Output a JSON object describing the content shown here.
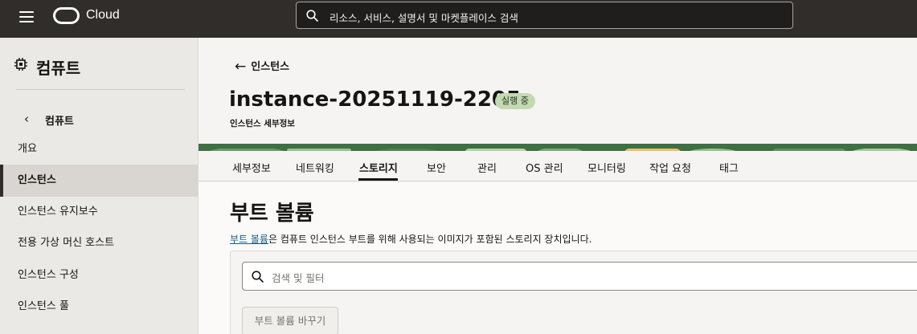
{
  "header": {
    "brand": "Cloud",
    "search_placeholder": "리소스, 서비스, 설명서 및 마켓플레이스 검색"
  },
  "sidebar": {
    "title": "컴퓨트",
    "back_label": "컴퓨트",
    "items": [
      {
        "label": "개요",
        "active": false
      },
      {
        "label": "인스턴스",
        "active": true
      },
      {
        "label": "인스턴스 유지보수",
        "active": false
      },
      {
        "label": "전용 가상 머신 호스트",
        "active": false
      },
      {
        "label": "인스턴스 구성",
        "active": false
      },
      {
        "label": "인스턴스 풀",
        "active": false
      }
    ]
  },
  "main": {
    "back_link": "인스턴스",
    "title": "instance-20251119-2205",
    "status": "실행 중",
    "subtitle": "인스턴스 세부정보",
    "tabs": [
      {
        "label": "세부정보",
        "active": false
      },
      {
        "label": "네트워킹",
        "active": false
      },
      {
        "label": "스토리지",
        "active": true
      },
      {
        "label": "보안",
        "active": false
      },
      {
        "label": "관리",
        "active": false
      },
      {
        "label": "OS 관리",
        "active": false
      },
      {
        "label": "모니터링",
        "active": false
      },
      {
        "label": "작업 요청",
        "active": false
      },
      {
        "label": "태그",
        "active": false
      }
    ],
    "section": {
      "title": "부트 볼륨",
      "desc_link": "부트 볼륨",
      "desc_rest": "은 컴퓨트 인스턴스 부트를 위해 사용되는 이미지가 포함된 스토리지 장치입니다.",
      "filter_placeholder": "검색 및 필터",
      "replace_button": "부트 볼륨 바꾸기"
    }
  },
  "colors": {
    "topbar": "#312d2a",
    "status_badge": "#c3d9b2",
    "link": "#1a5d8a"
  }
}
